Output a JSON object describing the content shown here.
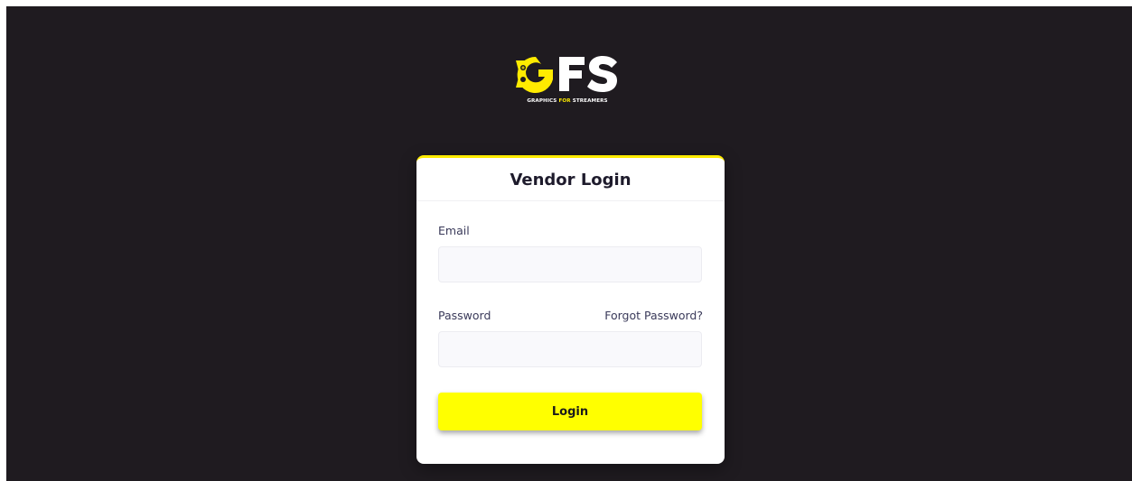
{
  "brand": {
    "logo_letters": "GFS",
    "tagline_pre": "GRAPHICS ",
    "tagline_highlight": "FOR",
    "tagline_post": " STREAMERS",
    "accent_color": "#ffeb00",
    "background_color": "#1f1b20"
  },
  "login_card": {
    "title": "Vendor Login",
    "email": {
      "label": "Email",
      "value": "",
      "placeholder": ""
    },
    "password": {
      "label": "Password",
      "value": "",
      "placeholder": ""
    },
    "forgot_password_label": "Forgot Password?",
    "submit_label": "Login",
    "button_color": "#ffff00"
  }
}
